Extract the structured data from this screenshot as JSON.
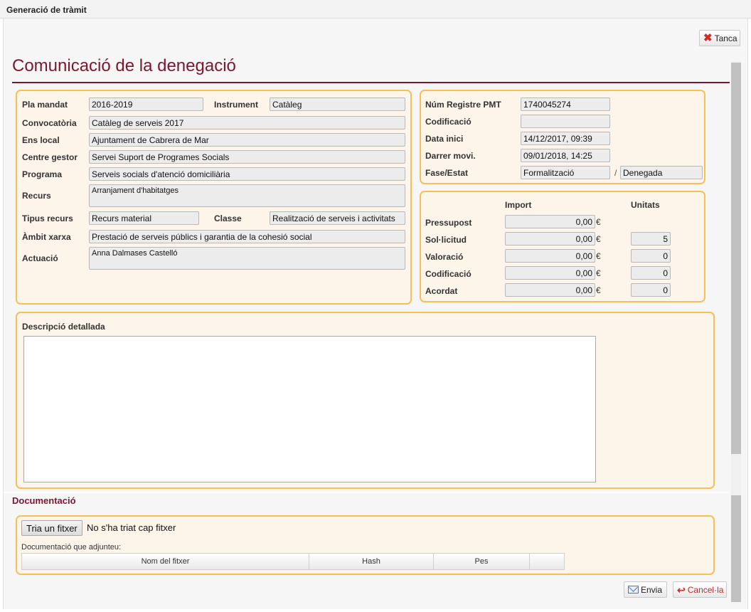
{
  "window": {
    "title": "Generació de tràmit"
  },
  "toolbar": {
    "close_label": "Tanca",
    "close_icon": "close-x-icon"
  },
  "page": {
    "title": "Comunicació de la denegació"
  },
  "general": {
    "pla_mandat_label": "Pla mandat",
    "pla_mandat": "2016-2019",
    "instrument_label": "Instrument",
    "instrument": "Catàleg",
    "convocatoria_label": "Convocatòria",
    "convocatoria": "Catàleg de serveis 2017",
    "ens_local_label": "Ens local",
    "ens_local": "Ajuntament de Cabrera de Mar",
    "centre_gestor_label": "Centre gestor",
    "centre_gestor": "Servei Suport de Programes Socials",
    "programa_label": "Programa",
    "programa": "Serveis socials d'atenció domiciliària",
    "recurs_label": "Recurs",
    "recurs": "Arranjament d'habitatges",
    "tipus_recurs_label": "Tipus recurs",
    "tipus_recurs": "Recurs material",
    "classe_label": "Classe",
    "classe": "Realització de serveis i activitats",
    "ambit_label": "Àmbit xarxa",
    "ambit": "Prestació de serveis públics i garantia de la cohesió social",
    "actuacio_label": "Actuació",
    "actuacio": "Anna Dalmases Castelló"
  },
  "registre": {
    "num_label": "Núm Registre PMT",
    "num": "1740045274",
    "codificacio_label": "Codificació",
    "codificacio": "",
    "data_inici_label": "Data inici",
    "data_inici": "14/12/2017, 09:39",
    "darrer_label": "Darrer movi.",
    "darrer": "09/01/2018, 14:25",
    "fase_label": "Fase/Estat",
    "fase": "Formalització",
    "sep": "/",
    "estat": "Denegada"
  },
  "imports": {
    "import_header": "Import",
    "unitats_header": "Unitats",
    "currency": "€",
    "rows": [
      {
        "label": "Pressupost",
        "import": "0,00",
        "unitats": null
      },
      {
        "label": "Sol·licitud",
        "import": "0,00",
        "unitats": "5"
      },
      {
        "label": "Valoració",
        "import": "0,00",
        "unitats": "0"
      },
      {
        "label": "Codificació",
        "import": "0,00",
        "unitats": "0"
      },
      {
        "label": "Acordat",
        "import": "0,00",
        "unitats": "0"
      }
    ]
  },
  "descripcio": {
    "label": "Descripció detallada",
    "value": ""
  },
  "documentacio": {
    "heading": "Documentació",
    "choose_label": "Tria un fitxer",
    "no_file": "No s'ha triat cap fitxer",
    "caption": "Documentació que adjunteu:",
    "columns": [
      "Nom del fitxer",
      "Hash",
      "Pes",
      ""
    ]
  },
  "footer": {
    "send_label": "Envia",
    "cancel_label": "Cancel·la"
  },
  "colors": {
    "accent": "#7b1730",
    "panel_border": "#f7bf57",
    "panel_bg": "#fdf4ea"
  }
}
